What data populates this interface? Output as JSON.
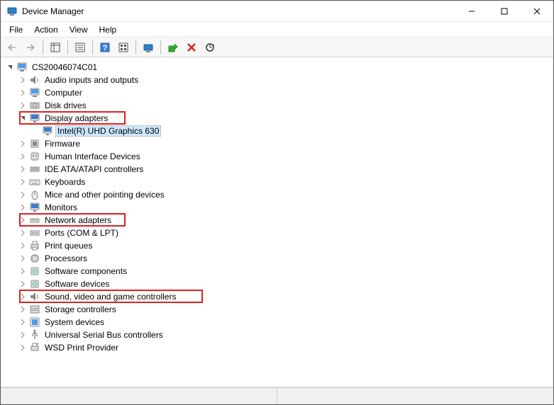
{
  "window": {
    "title": "Device Manager"
  },
  "menubar": [
    {
      "label": "File"
    },
    {
      "label": "Action"
    },
    {
      "label": "View"
    },
    {
      "label": "Help"
    }
  ],
  "toolbar": {
    "back": "Back",
    "forward": "Forward",
    "show_hide": "Show/Hide Console Tree",
    "properties": "Properties",
    "help": "Help",
    "action_center": "Action",
    "update": "Update driver",
    "uninstall": "Uninstall device",
    "disable": "Disable device",
    "scan": "Scan for hardware changes"
  },
  "tree": {
    "root": "CS20046074C01",
    "items": [
      {
        "label": "Audio inputs and outputs"
      },
      {
        "label": "Computer"
      },
      {
        "label": "Disk drives"
      },
      {
        "label": "Display adapters",
        "expanded": true,
        "highlighted": true,
        "children": [
          {
            "label": "Intel(R) UHD Graphics 630",
            "selected": true
          }
        ]
      },
      {
        "label": "Firmware"
      },
      {
        "label": "Human Interface Devices"
      },
      {
        "label": "IDE ATA/ATAPI controllers"
      },
      {
        "label": "Keyboards"
      },
      {
        "label": "Mice and other pointing devices"
      },
      {
        "label": "Monitors"
      },
      {
        "label": "Network adapters",
        "highlighted": true
      },
      {
        "label": "Ports (COM & LPT)"
      },
      {
        "label": "Print queues"
      },
      {
        "label": "Processors"
      },
      {
        "label": "Software components"
      },
      {
        "label": "Software devices"
      },
      {
        "label": "Sound, video and game controllers",
        "highlighted": true
      },
      {
        "label": "Storage controllers"
      },
      {
        "label": "System devices"
      },
      {
        "label": "Universal Serial Bus controllers"
      },
      {
        "label": "WSD Print Provider"
      }
    ]
  }
}
